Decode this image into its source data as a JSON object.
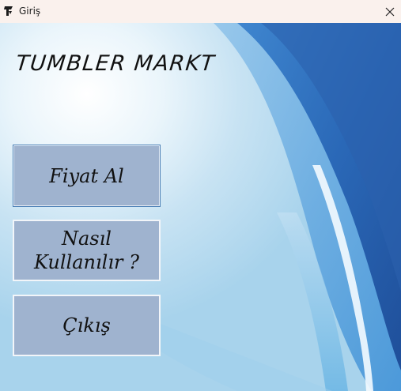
{
  "window": {
    "title": "Giriş",
    "app_icon": "logo-icon",
    "close_icon": "close-icon"
  },
  "app": {
    "heading": "TUMBLER MARKT"
  },
  "menu": {
    "price_label": "Fiyat Al",
    "howto_label": "Nasıl Kullanılır ?",
    "exit_label": "Çıkış"
  },
  "colors": {
    "titlebar": "#faf1ed",
    "button_fill": "#9fb3cf",
    "accent_blue": "#2a63b0"
  }
}
